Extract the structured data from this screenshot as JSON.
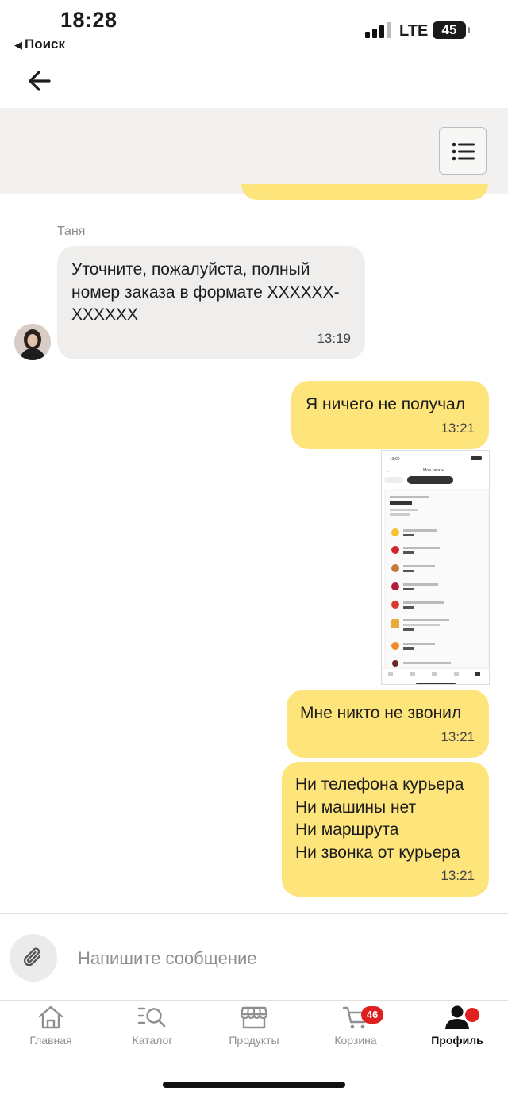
{
  "status_bar": {
    "time": "18:28",
    "back_app": "Поиск",
    "network": "LTE",
    "battery": "45"
  },
  "chat": {
    "agent_name": "Таня",
    "messages": [
      {
        "direction": "in",
        "text": "Уточните, пожалуйста, полный номер заказа в формате XXXXXX-XXXXXX",
        "time": "13:19"
      },
      {
        "direction": "out",
        "text": "Я ничего не получал",
        "time": "13:21"
      },
      {
        "direction": "out",
        "type": "image",
        "content": "screenshot-of-orders"
      },
      {
        "direction": "out",
        "text": "Мне никто не звонил",
        "time": "13:21"
      },
      {
        "direction": "out",
        "text": "Ни телефона курьера\nНи машины нет\nНи маршрута\nНи звонка от курьера",
        "time": "13:21"
      }
    ]
  },
  "composer": {
    "placeholder": "Напишите сообщение"
  },
  "tab_bar": {
    "tabs": [
      {
        "label": "Главная",
        "icon": "home-icon",
        "active": false
      },
      {
        "label": "Каталог",
        "icon": "catalog-search-icon",
        "active": false
      },
      {
        "label": "Продукты",
        "icon": "store-icon",
        "active": false
      },
      {
        "label": "Корзина",
        "icon": "cart-icon",
        "active": false,
        "badge": "46"
      },
      {
        "label": "Профиль",
        "icon": "profile-icon",
        "active": true
      }
    ]
  },
  "colors": {
    "outgoing_bubble": "#fde47b",
    "incoming_bubble": "#efeeec",
    "badge": "#e02020",
    "header_panel": "#f2f1ef"
  }
}
